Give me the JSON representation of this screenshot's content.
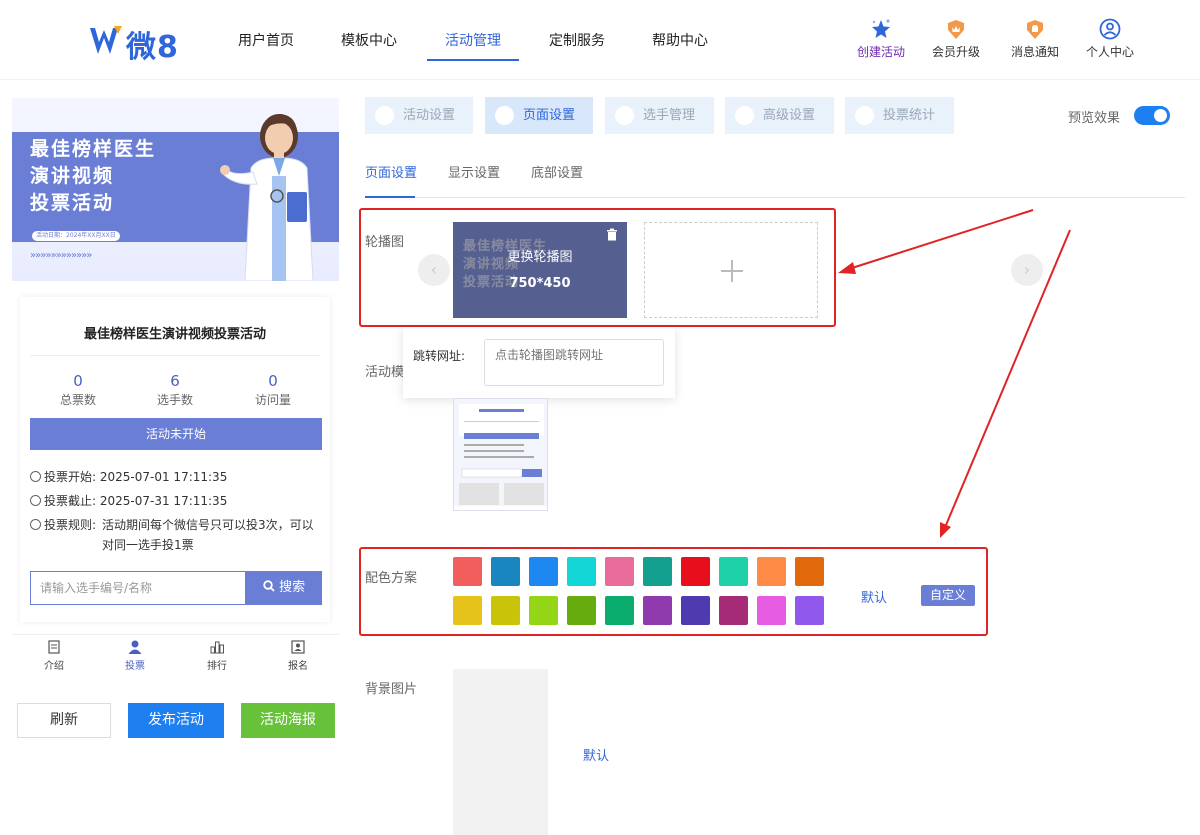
{
  "header": {
    "logo_text": "微8",
    "nav": [
      "用户首页",
      "模板中心",
      "活动管理",
      "定制服务",
      "帮助中心"
    ],
    "actions": [
      "创建活动",
      "会员升级",
      "消息通知",
      "个人中心"
    ]
  },
  "preview": {
    "banner_title": [
      "最佳榜样医生",
      "演讲视频",
      "投票活动"
    ],
    "banner_date": "活动日期：2024年XX月XX日",
    "banner_arrows": "»»»»»»»»»»»»",
    "card_title": "最佳榜样医生演讲视频投票活动",
    "stats": [
      {
        "value": "0",
        "label": "总票数"
      },
      {
        "value": "6",
        "label": "选手数"
      },
      {
        "value": "0",
        "label": "访问量"
      }
    ],
    "status_button": "活动未开始",
    "vote_start_label": "投票开始:",
    "vote_start": "2025-07-01 17:11:35",
    "vote_end_label": "投票截止:",
    "vote_end": "2025-07-31 17:11:35",
    "rule_label": "投票规则:",
    "rule_text": "活动期间每个微信号只可以投3次，可以对同一选手投1票",
    "search_placeholder": "请输入选手编号/名称",
    "search_button": "搜索",
    "tabs": [
      "介绍",
      "投票",
      "排行",
      "报名"
    ]
  },
  "bottom_buttons": {
    "refresh": "刷新",
    "publish": "发布活动",
    "poster": "活动海报"
  },
  "settings": {
    "top_tabs": [
      "活动设置",
      "页面设置",
      "选手管理",
      "高级设置",
      "投票统计"
    ],
    "preview_label": "预览效果",
    "sub_tabs": [
      "页面设置",
      "显示设置",
      "底部设置"
    ],
    "carousel_label": "轮播图",
    "carousel_change": "更换轮播图",
    "carousel_size": "750*450",
    "carousel_image_text": [
      "最佳榜样医生",
      "演讲视频",
      "投票活动"
    ],
    "jump_label": "跳转网址:",
    "jump_placeholder": "点击轮播图跳转网址",
    "template_label": "活动模",
    "color_label": "配色方案",
    "colors_row1": [
      "#f25e5e",
      "#1a86c0",
      "#1e88f0",
      "#12d5d5",
      "#e96b9a",
      "#14a08e",
      "#e60f1b",
      "#1ed1a8",
      "#ff8a46",
      "#e2680c"
    ],
    "colors_row2": [
      "#e6c31a",
      "#c9c40a",
      "#95d517",
      "#66ac0e",
      "#0bad6e",
      "#8f3aad",
      "#4f3ab0",
      "#a62b76",
      "#e65ce3",
      "#9158ee"
    ],
    "color_default": "默认",
    "color_custom": "自定义",
    "bg_label": "背景图片",
    "bg_default": "默认"
  }
}
